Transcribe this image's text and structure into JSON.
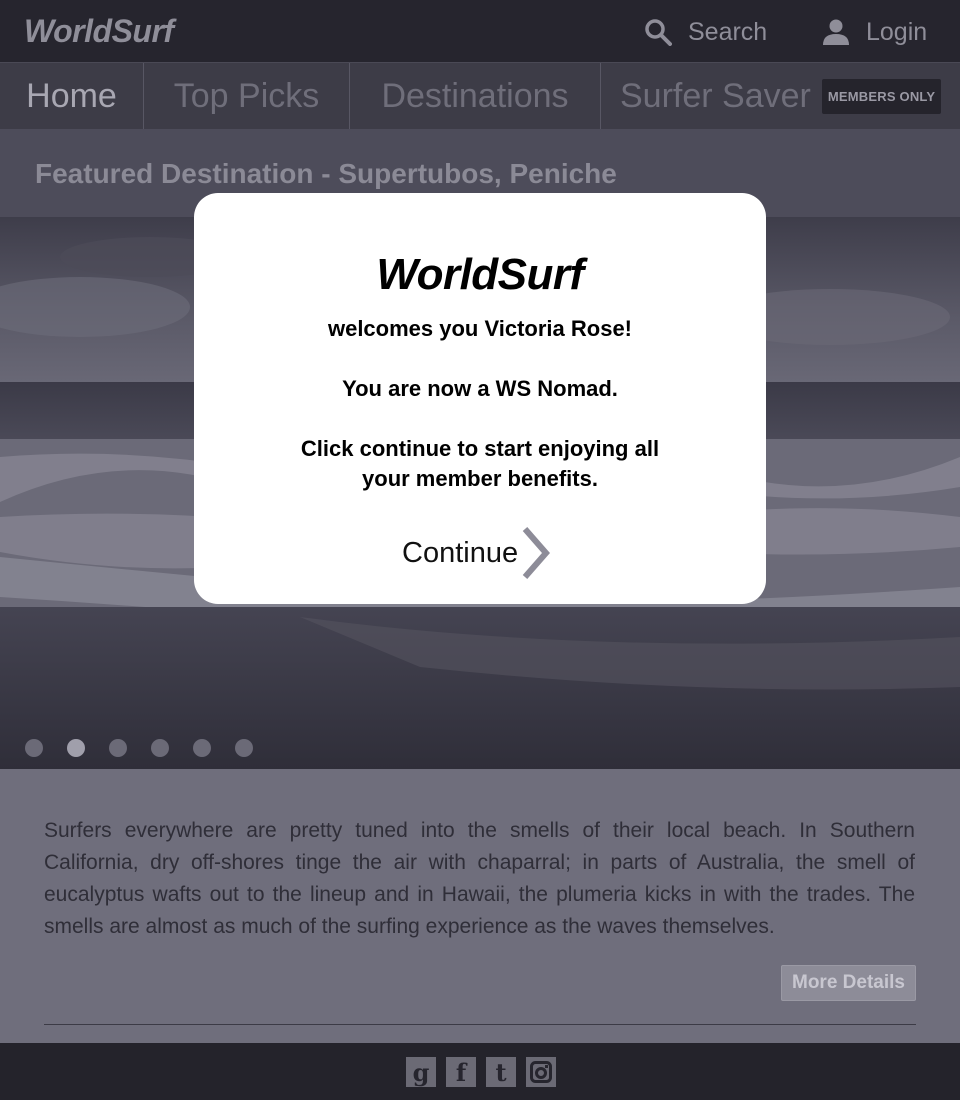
{
  "app": {
    "logo": "WorldSurf"
  },
  "topbar": {
    "search_label": "Search",
    "login_label": "Login"
  },
  "nav": {
    "items": [
      {
        "label": "Home",
        "active": true
      },
      {
        "label": "Top Picks",
        "active": false
      },
      {
        "label": "Destinations",
        "active": false
      },
      {
        "label": "Surfer Saver",
        "active": false
      }
    ],
    "badge": "MEMBERS ONLY"
  },
  "hero": {
    "title": "Featured Destination - Supertubos, Peniche",
    "slides_total": 6,
    "active_slide": 2
  },
  "description": {
    "text": "Surfers everywhere are pretty tuned into the smells of their local beach. In Southern California, dry off-shores tinge the air with chaparral; in parts of Australia, the smell of eucalyptus wafts out to the lineup and in Hawaii, the plumeria kicks in with the trades. The smells are almost as much of the surfing experience as the waves themselves.",
    "more_label": "More Details"
  },
  "footer": {
    "social_icons": [
      "google-plus-icon",
      "facebook-icon",
      "twitter-icon",
      "instagram-icon"
    ]
  },
  "modal": {
    "brand": "WorldSurf",
    "line1": "welcomes you Victoria Rose!",
    "line2": "You are now a WS Nomad.",
    "line3a": "Click continue to start enjoying all",
    "line3b": "your member benefits.",
    "continue_label": "Continue"
  },
  "colors": {
    "background": "#26252e",
    "modal": "#ffffff",
    "accent": "#8d8c98"
  }
}
